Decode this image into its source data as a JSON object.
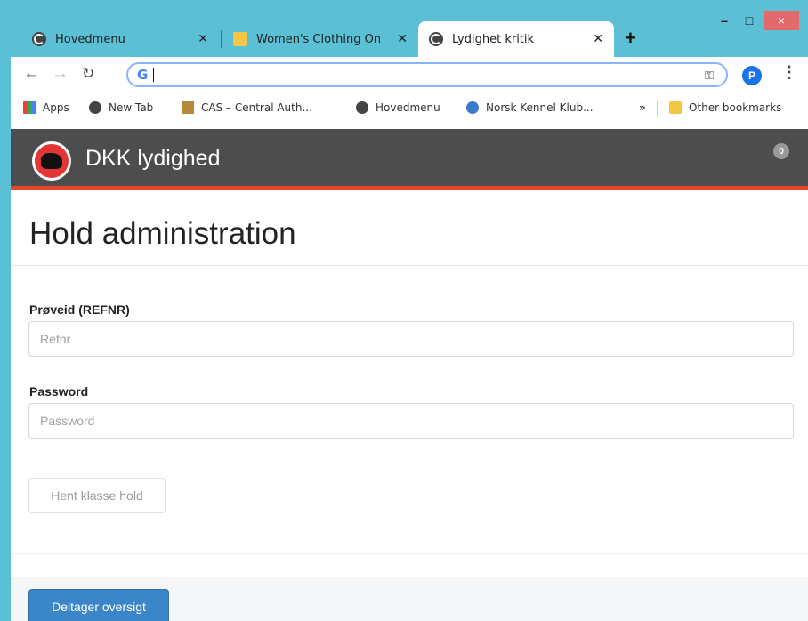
{
  "browser": {
    "tabs": [
      {
        "label": "Hovedmenu",
        "icon": "globe-icon",
        "active": false
      },
      {
        "label": "Women's Clothing On",
        "icon": "site-favicon-icon",
        "active": false
      },
      {
        "label": "Lydighet kritik",
        "icon": "globe-icon",
        "active": true
      }
    ],
    "new_tab_symbol": "+",
    "window_controls": {
      "minimize": "–",
      "maximize": "□",
      "close": "×"
    },
    "address_bar": {
      "value": "",
      "search_logo": "G"
    },
    "profile_initial": "P",
    "bookmarks": [
      {
        "label": "Apps",
        "icon": "apps-grid-icon"
      },
      {
        "label": "New Tab",
        "icon": "globe-icon"
      },
      {
        "label": "CAS – Central Auth...",
        "icon": "cas-icon"
      },
      {
        "label": "Hovedmenu",
        "icon": "globe-icon"
      },
      {
        "label": "Norsk Kennel Klub...",
        "icon": "nkk-icon"
      }
    ],
    "bookmarks_overflow": "»",
    "other_bookmarks": "Other bookmarks"
  },
  "app": {
    "brand": "DKK lydighed",
    "notification_count": "0",
    "accent_color": "#e8452c",
    "navbar_color": "#4d4d4d"
  },
  "page": {
    "title": "Hold administration",
    "form": {
      "refnr_label": "Prøveid (REFNR)",
      "refnr_placeholder": "Refnr",
      "password_label": "Password",
      "password_placeholder": "Password",
      "fetch_button": "Hent klasse hold"
    },
    "footer_button": "Deltager oversigt",
    "primary_color": "#3b86c9"
  }
}
